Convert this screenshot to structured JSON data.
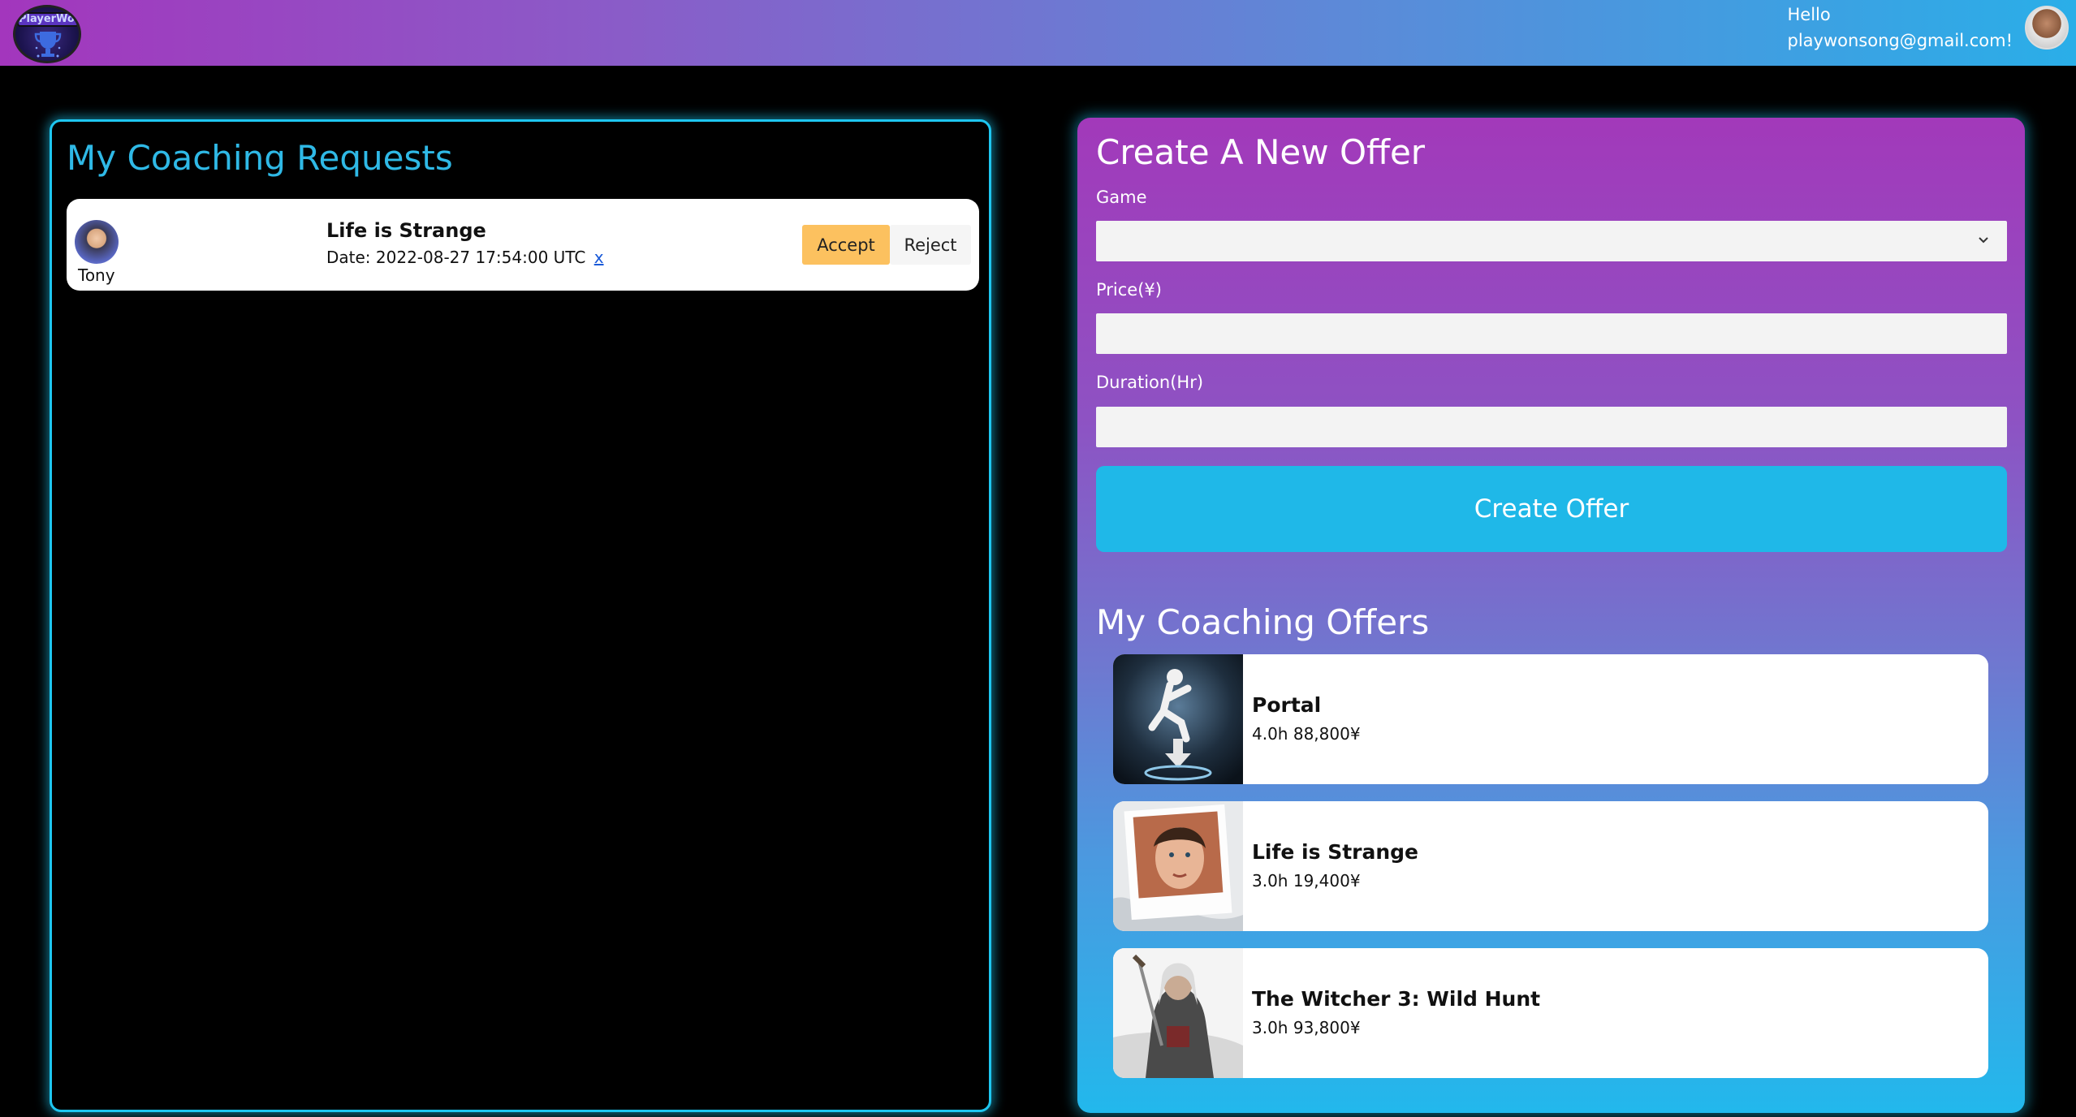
{
  "header": {
    "hello_line1": "Hello",
    "hello_line2": "playwonsong@gmail.com!",
    "logo_text": "PlayerWon"
  },
  "requests": {
    "title": "My Coaching Requests",
    "items": [
      {
        "user": "Tony",
        "game": "Life is Strange",
        "date": "Date: 2022-08-27 17:54:00 UTC",
        "remove": "x",
        "accept_label": "Accept",
        "reject_label": "Reject"
      }
    ]
  },
  "create_offer": {
    "title": "Create A New Offer",
    "game_label": "Game",
    "game_value": "",
    "price_label": "Price(¥)",
    "price_value": "",
    "duration_label": "Duration(Hr)",
    "duration_value": "",
    "submit_label": "Create Offer"
  },
  "offers": {
    "title": "My Coaching Offers",
    "items": [
      {
        "game": "Portal",
        "meta": "4.0h 88,800¥"
      },
      {
        "game": "Life is Strange",
        "meta": "3.0h 19,400¥"
      },
      {
        "game": "The Witcher 3: Wild Hunt",
        "meta": "3.0h 93,800¥"
      }
    ]
  },
  "colors": {
    "accent_cyan": "#1ec6f0",
    "accept": "#fcc15f",
    "gradient_start": "#a336bd",
    "gradient_end": "#2aaee8"
  }
}
